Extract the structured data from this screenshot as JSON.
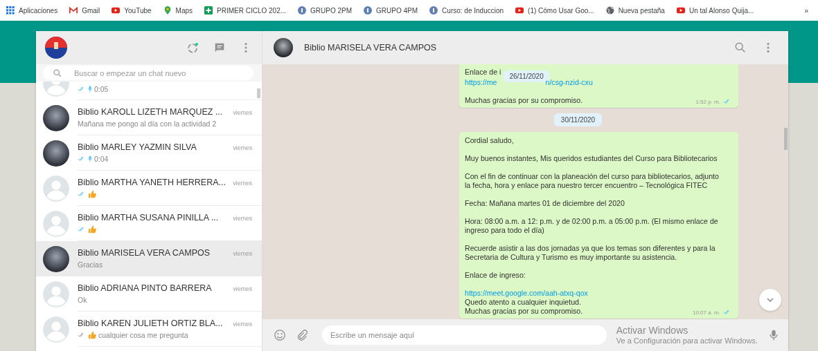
{
  "bookmarks": [
    {
      "kind": "grid",
      "label": "Aplicaciones"
    },
    {
      "kind": "mail",
      "label": "Gmail"
    },
    {
      "kind": "video",
      "label": "YouTube"
    },
    {
      "kind": "pin",
      "label": "Maps"
    },
    {
      "kind": "plus-square",
      "label": "PRIMER CICLO 202..."
    },
    {
      "kind": "info",
      "label": "GRUPO 2PM"
    },
    {
      "kind": "info",
      "label": "GRUPO 4PM"
    },
    {
      "kind": "info",
      "label": "Curso: de Induccion"
    },
    {
      "kind": "video",
      "label": "(1) Cómo Usar Goo..."
    },
    {
      "kind": "globe",
      "label": "Nueva pestaña"
    },
    {
      "kind": "video",
      "label": "Un tal Alonso Quija..."
    }
  ],
  "bookmarks_more": "»",
  "sidebar": {
    "search": {
      "placeholder": "Buscar o empezar un chat nuevo"
    },
    "chats": [
      {
        "kind": "default",
        "preview": {
          "kind": "voice",
          "read": true,
          "text": "0:05"
        }
      },
      {
        "kind": "photo",
        "name": "Biblio KAROLL LIZETH MARQUEZ ...",
        "time": "viernes",
        "selected": false,
        "preview": {
          "kind": "text",
          "text": "Mañana me pongo al día con la actividad 2"
        }
      },
      {
        "kind": "photo",
        "name": "Biblio MARLEY YAZMIN SILVA",
        "time": "viernes",
        "selected": false,
        "preview": {
          "kind": "voice",
          "read": true,
          "text": "0:04"
        }
      },
      {
        "kind": "default",
        "name": "Biblio MARTHA YANETH HERRERA...",
        "time": "viernes",
        "selected": false,
        "preview": {
          "kind": "emoji",
          "read": true
        }
      },
      {
        "kind": "default",
        "name": "Biblio MARTHA SUSANA PINILLA ...",
        "time": "viernes",
        "selected": false,
        "preview": {
          "kind": "emoji",
          "read": true
        }
      },
      {
        "kind": "photo",
        "name": "Biblio MARISELA  VERA CAMPOS",
        "time": "viernes",
        "selected": true,
        "preview": {
          "kind": "text",
          "text": "Gracias"
        }
      },
      {
        "kind": "default",
        "name": "Biblio ADRIANA PINTO BARRERA",
        "time": "viernes",
        "selected": false,
        "preview": {
          "kind": "text",
          "text": "Ok"
        }
      },
      {
        "kind": "default",
        "name": "Biblio KAREN JULIETH ORTIZ BLA...",
        "time": "viernes",
        "selected": false,
        "preview": {
          "kind": "emoji",
          "read": false,
          "text": "cualquier cosa me pregunta"
        }
      }
    ]
  },
  "chat": {
    "title": "Biblio MARISELA  VERA CAMPOS",
    "floating_date": "26/11/2020",
    "items": [
      {
        "kind": "message",
        "paragraphs": [
          {
            "lines": [
              {
                "parts": [
                  {
                    "text": "Enlace de i"
                  }
                ]
              },
              {
                "parts": [
                  {
                    "text": "https://me",
                    "link": true
                  },
                  {
                    "text": "n/csg-nzid-cxu",
                    "link": true
                  }
                ]
              }
            ]
          },
          {
            "lines": [
              {
                "parts": [
                  {
                    "text": "Muchas gracias por su compromiso."
                  }
                ]
              }
            ]
          }
        ],
        "time": "1:52 p. m.",
        "read": true
      },
      {
        "kind": "date",
        "text": "30/11/2020"
      },
      {
        "kind": "message",
        "paragraphs": [
          {
            "lines": [
              {
                "parts": [
                  {
                    "text": "Cordial saludo,"
                  }
                ]
              }
            ]
          },
          {
            "lines": [
              {
                "parts": [
                  {
                    "text": "Muy buenos instantes, Mis queridos estudiantes del Curso para Bibliotecarios"
                  }
                ]
              }
            ]
          },
          {
            "lines": [
              {
                "parts": [
                  {
                    "text": "Con el fin de continuar con la planeación del curso para bibliotecarios, adjunto"
                  }
                ]
              },
              {
                "parts": [
                  {
                    "text": "la fecha, hora y enlace para nuestro tercer encuentro – Tecnológica FITEC"
                  }
                ]
              }
            ]
          },
          {
            "lines": [
              {
                "parts": [
                  {
                    "text": "Fecha: Mañana martes 01 de diciembre del 2020"
                  }
                ]
              }
            ]
          },
          {
            "lines": [
              {
                "parts": [
                  {
                    "text": "Hora:  08:00 a.m. a 12: p.m. y de 02:00 p.m. a 05:00 p.m. (El mismo enlace de"
                  }
                ]
              },
              {
                "parts": [
                  {
                    "text": "ingreso para todo el día)"
                  }
                ]
              }
            ]
          },
          {
            "lines": [
              {
                "parts": [
                  {
                    "text": "Recuerde asistir a las dos jornadas ya que los temas son diferentes y para la"
                  }
                ]
              },
              {
                "parts": [
                  {
                    "text": "Secretaria de Cultura y Turismo es muy importante su asistencia."
                  }
                ]
              }
            ]
          },
          {
            "lines": [
              {
                "parts": [
                  {
                    "text": "Enlace de ingreso:"
                  }
                ]
              }
            ]
          },
          {
            "lines": [
              {
                "parts": [
                  {
                    "text": "https://meet.google.com/aah-atxq-qox",
                    "link": true
                  }
                ]
              },
              {
                "parts": [
                  {
                    "text": "Quedo atento a cualquier inquietud."
                  }
                ]
              },
              {
                "parts": [
                  {
                    "text": "Muchas gracias por su compromiso."
                  }
                ]
              }
            ]
          }
        ],
        "time": "10:07 a. m.",
        "read": true
      }
    ],
    "composer": {
      "placeholder": "Escribe un mensaje aquí"
    }
  },
  "activation_notice": {
    "title": "Activar Windows",
    "text": "Ve a Configuración para activar Windows."
  }
}
